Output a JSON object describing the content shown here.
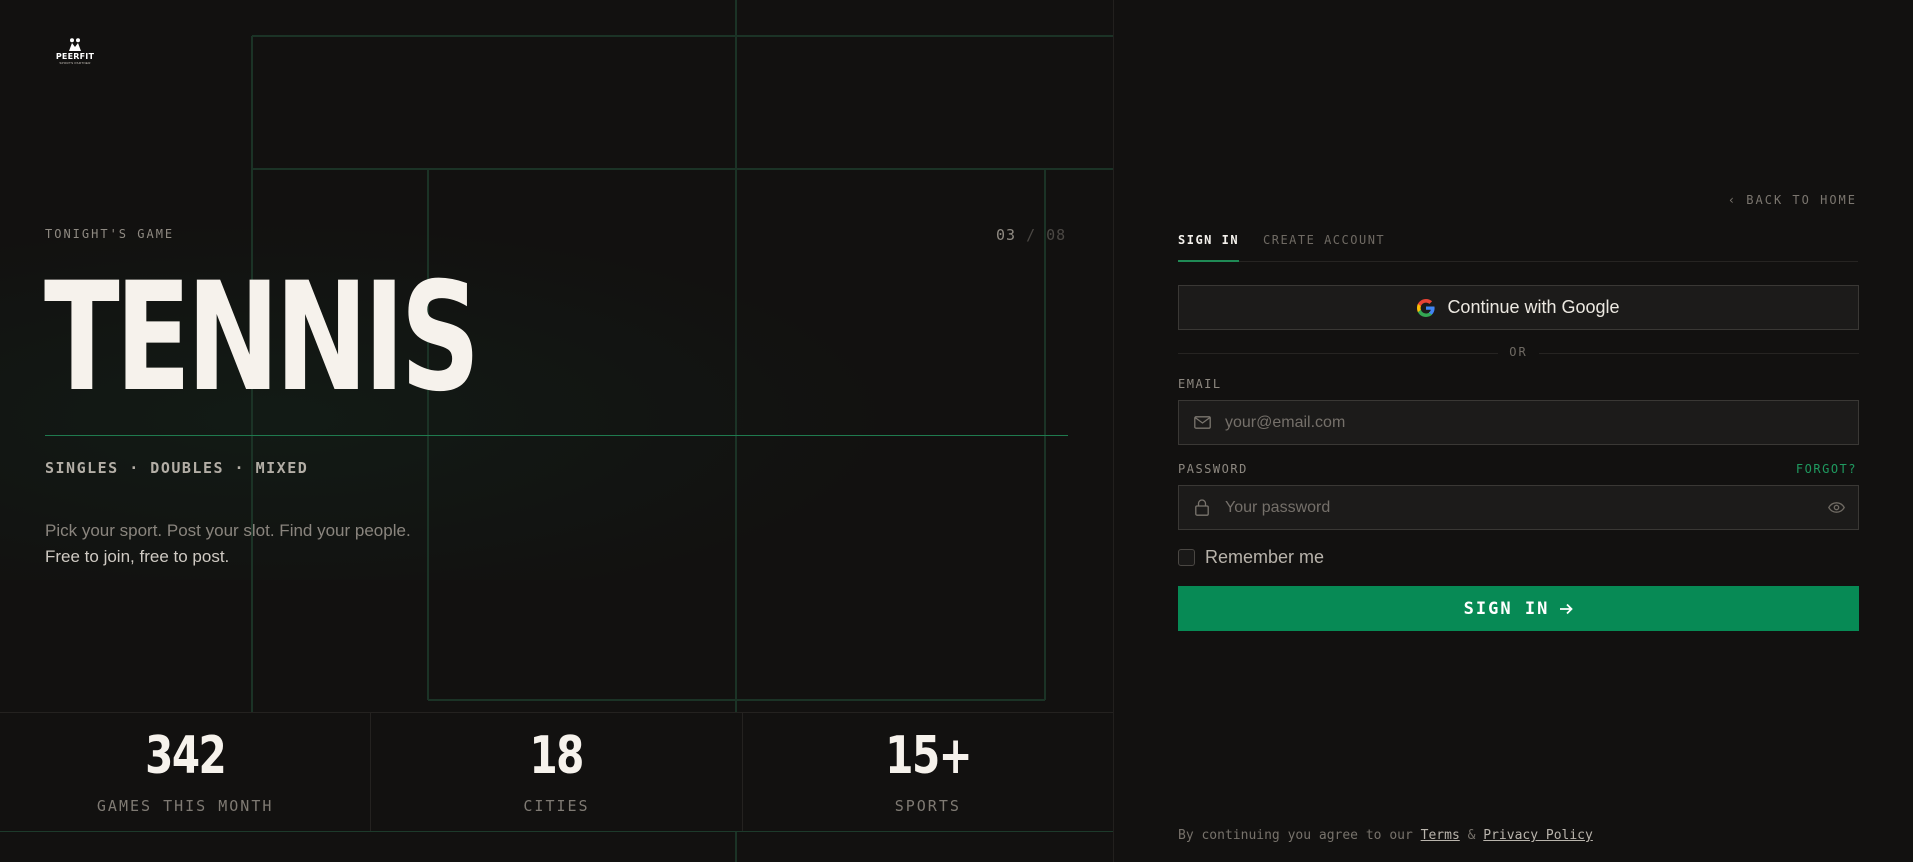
{
  "brand": {
    "name": "PEERFIT",
    "tagline": "SPORTS PARTNER"
  },
  "hero": {
    "eyebrow": "TONIGHT'S GAME",
    "counter_current": "03",
    "counter_separator": "/",
    "counter_total": "08",
    "sport": "TENNIS",
    "formats": "SINGLES · DOUBLES · MIXED",
    "pitch_line1": "Pick your sport. Post your slot. Find your people.",
    "pitch_line2": "Free to join, free to post."
  },
  "stats": [
    {
      "value": "342",
      "label": "GAMES THIS MONTH"
    },
    {
      "value": "18",
      "label": "CITIES"
    },
    {
      "value": "15+",
      "label": "SPORTS"
    }
  ],
  "auth": {
    "back_link": "BACK TO HOME",
    "tabs": [
      {
        "label": "SIGN IN",
        "active": true
      },
      {
        "label": "CREATE ACCOUNT",
        "active": false
      }
    ],
    "google_label": "Continue with Google",
    "divider": "OR",
    "email_label": "EMAIL",
    "email_placeholder": "your@email.com",
    "email_value": "",
    "password_label": "PASSWORD",
    "forgot": "FORGOT?",
    "password_placeholder": "Your password",
    "password_value": "",
    "remember_label": "Remember me",
    "remember_checked": false,
    "submit_label": "SIGN IN",
    "legal_prefix": "By continuing you agree to our",
    "terms": "Terms",
    "legal_and": "&",
    "privacy": "Privacy Policy"
  },
  "colors": {
    "background": "#121110",
    "accent": "#078a55",
    "accent_text": "#1f9a60",
    "court_lines": "#1d3a2b",
    "text_primary": "#f6f2ec"
  },
  "icons": [
    "logo-mark",
    "chevron-left-icon",
    "google-icon",
    "mail-icon",
    "lock-icon",
    "eye-icon",
    "arrow-right-icon"
  ]
}
